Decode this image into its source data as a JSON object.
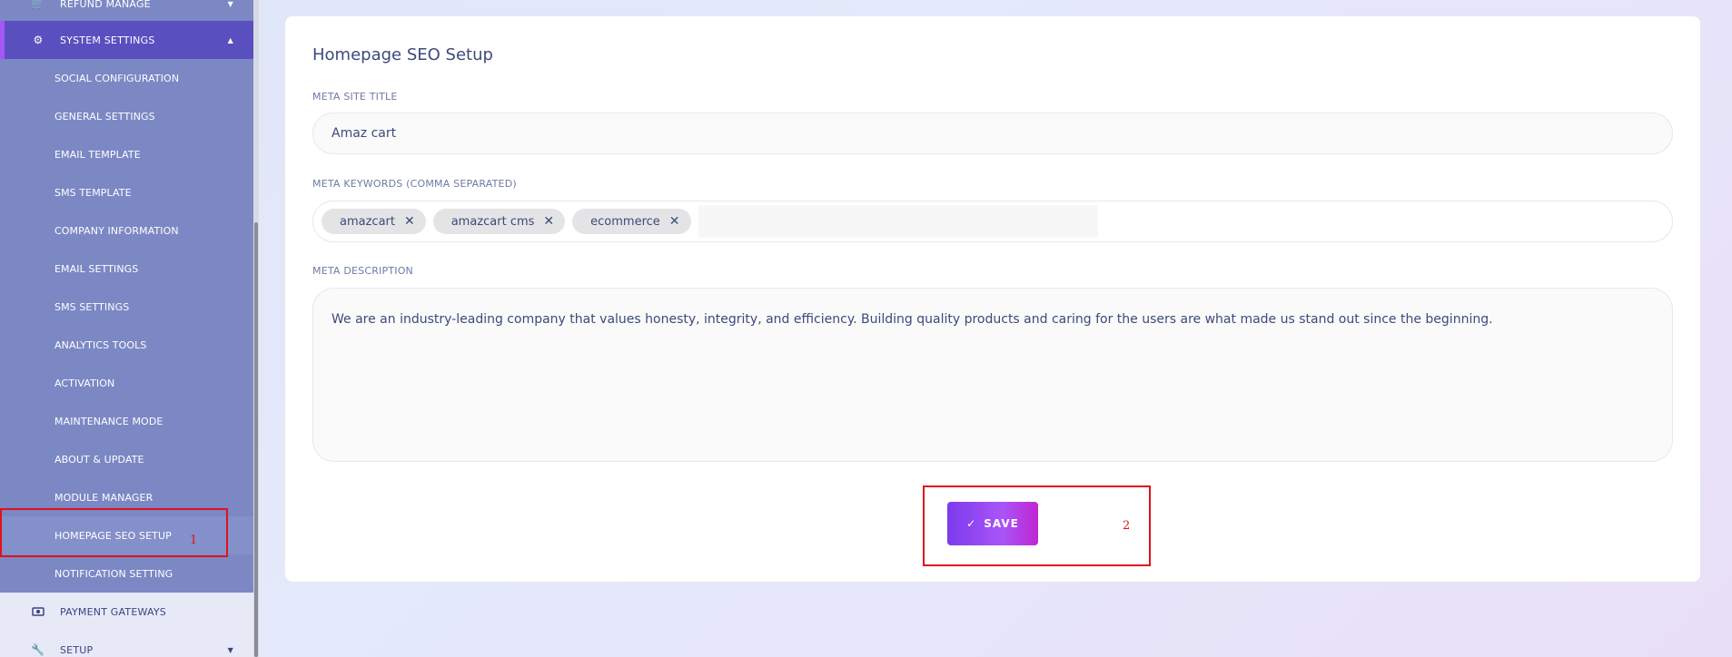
{
  "sidebar": {
    "top_item": {
      "label": "REFUND MANAGE",
      "icon": "cart-icon"
    },
    "system_settings": {
      "label": "SYSTEM SETTINGS",
      "icon": "gear-icon"
    },
    "sub_items": [
      "SOCIAL CONFIGURATION",
      "GENERAL SETTINGS",
      "EMAIL TEMPLATE",
      "SMS TEMPLATE",
      "COMPANY INFORMATION",
      "EMAIL SETTINGS",
      "SMS SETTINGS",
      "ANALYTICS TOOLS",
      "ACTIVATION",
      "MAINTENANCE MODE",
      "ABOUT & UPDATE",
      "MODULE MANAGER",
      "HOMEPAGE SEO SETUP",
      "NOTIFICATION SETTING"
    ],
    "payment_gateways": {
      "label": "PAYMENT GATEWAYS",
      "icon": "money-icon"
    },
    "setup": {
      "label": "SETUP",
      "icon": "wrench-icon"
    }
  },
  "annotations": {
    "one": "1",
    "two": "2"
  },
  "form": {
    "title": "Homepage SEO Setup",
    "meta_title_label": "META SITE TITLE",
    "meta_title_value": "Amaz cart",
    "keywords_label": "META KEYWORDS (COMMA SEPARATED)",
    "keywords": [
      "amazcart",
      "amazcart cms",
      "ecommerce"
    ],
    "description_label": "META DESCRIPTION",
    "description_value": "We are an industry-leading company that values honesty, integrity, and efficiency. Building quality products and caring for the users are what made us stand out since the beginning.",
    "save_label": "SAVE",
    "save_icon": "✓"
  }
}
